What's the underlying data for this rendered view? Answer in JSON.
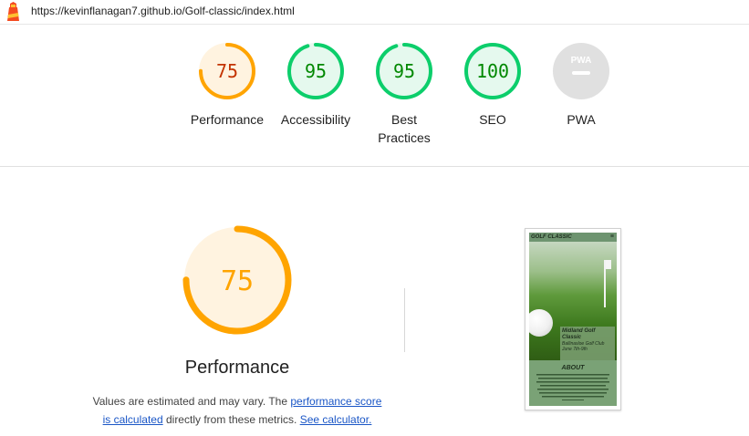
{
  "topbar": {
    "url": "https://kevinflanagan7.github.io/Golf-classic/index.html",
    "logo_icon": "lighthouse-icon"
  },
  "gauges": [
    {
      "label": "Performance",
      "score": "75",
      "value": 75,
      "color": "#ffa400",
      "text_color": "#c33300",
      "bg": "#fff3e0"
    },
    {
      "label": "Accessibility",
      "score": "95",
      "value": 95,
      "color": "#0cce6b",
      "text_color": "#008800",
      "bg": "#e5f9ee"
    },
    {
      "label": "Best\nPractices",
      "score": "95",
      "value": 95,
      "color": "#0cce6b",
      "text_color": "#008800",
      "bg": "#e5f9ee"
    },
    {
      "label": "SEO",
      "score": "100",
      "value": 100,
      "color": "#0cce6b",
      "text_color": "#008800",
      "bg": "#e5f9ee"
    },
    {
      "label": "PWA",
      "score": "PWA",
      "value": 0,
      "color": "#e0e0e0",
      "text_color": "#ffffff",
      "bg": "#e0e0e0"
    }
  ],
  "performance": {
    "score": "75",
    "value": 75,
    "title": "Performance",
    "desc_prefix": "Values are estimated and may vary. The ",
    "desc_link": "performance score is calculated",
    "desc_middle": " directly from these metrics. ",
    "desc_calc": "See calculator.",
    "color": "#ffa400",
    "bg": "#fff3e0"
  },
  "screenshot": {
    "site_title": "GOLF CLASSIC",
    "menu_icon": "hamburger-icon",
    "hero_heading": "Midland Golf Classic",
    "hero_sub": "Ballinasloe Golf Club June 7th-9th",
    "about_title": "ABOUT"
  }
}
